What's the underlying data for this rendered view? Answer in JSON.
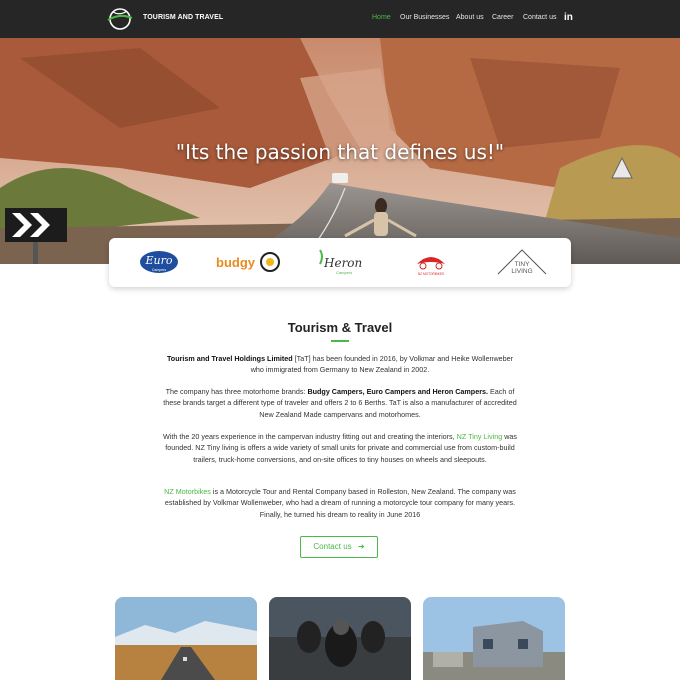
{
  "nav": {
    "brand": "TOURISM AND TRAVEL",
    "items": [
      {
        "label": "Home",
        "active": true
      },
      {
        "label": "Our Businesses",
        "active": false
      },
      {
        "label": "About us",
        "active": false
      },
      {
        "label": "Career",
        "active": false
      },
      {
        "label": "Contact us",
        "active": false
      }
    ],
    "social_icon": "linkedin-icon",
    "social_glyph": "in"
  },
  "hero": {
    "quote": "\"Its the passion that defines us!\""
  },
  "brands": [
    {
      "name": "Euro",
      "sub": "Campers"
    },
    {
      "name": "budgy",
      "sub": ""
    },
    {
      "name": "Heron",
      "sub": "Campers"
    },
    {
      "name": "",
      "sub": "NZ MOTORBIKES"
    },
    {
      "name": "TINY",
      "sub": "LIVING"
    }
  ],
  "section": {
    "title": "Tourism & Travel",
    "p1_bold": "Tourism and Travel Holdings Limited",
    "p1_rest": " [TaT] has been founded in 2016, by Volkmar and Heike Wollenweber who immigrated from Germany to New Zealand in 2002.",
    "p2_start": "The company has three motorhome brands: ",
    "p2_bold": "Budgy Campers, Euro Campers and Heron Campers.",
    "p2_rest": " Each of these brands target a different type of traveler and offers 2 to 6 Berths. TaT is also a manufacturer of accredited New Zealand Made campervans and motorhomes.",
    "p3_start": "With the 20 years experience in the campervan industry fitting out and creating the interiors, ",
    "p3_link": "NZ Tiny Living",
    "p3_rest": "  was founded. NZ Tiny living is offers a wide variety of small units for private and commercial use from custom-build trailers, truck-home conversions, and on-site offices to tiny houses on wheels and sleepouts.",
    "p4_link": "NZ Motorbikes",
    "p4_rest": " is a Motorcycle Tour and Rental Company based in Rolleston, New Zealand. The company was established by Volkmar Wollenweber, who had a dream of running a motorcycle tour company for many years. Finally, he turned his dream to reality in June 2016",
    "cta_label": "Contact us",
    "cta_icon": "arrow-right-icon"
  },
  "colors": {
    "accent": "#4cb848",
    "nav_bg": "#262626"
  }
}
